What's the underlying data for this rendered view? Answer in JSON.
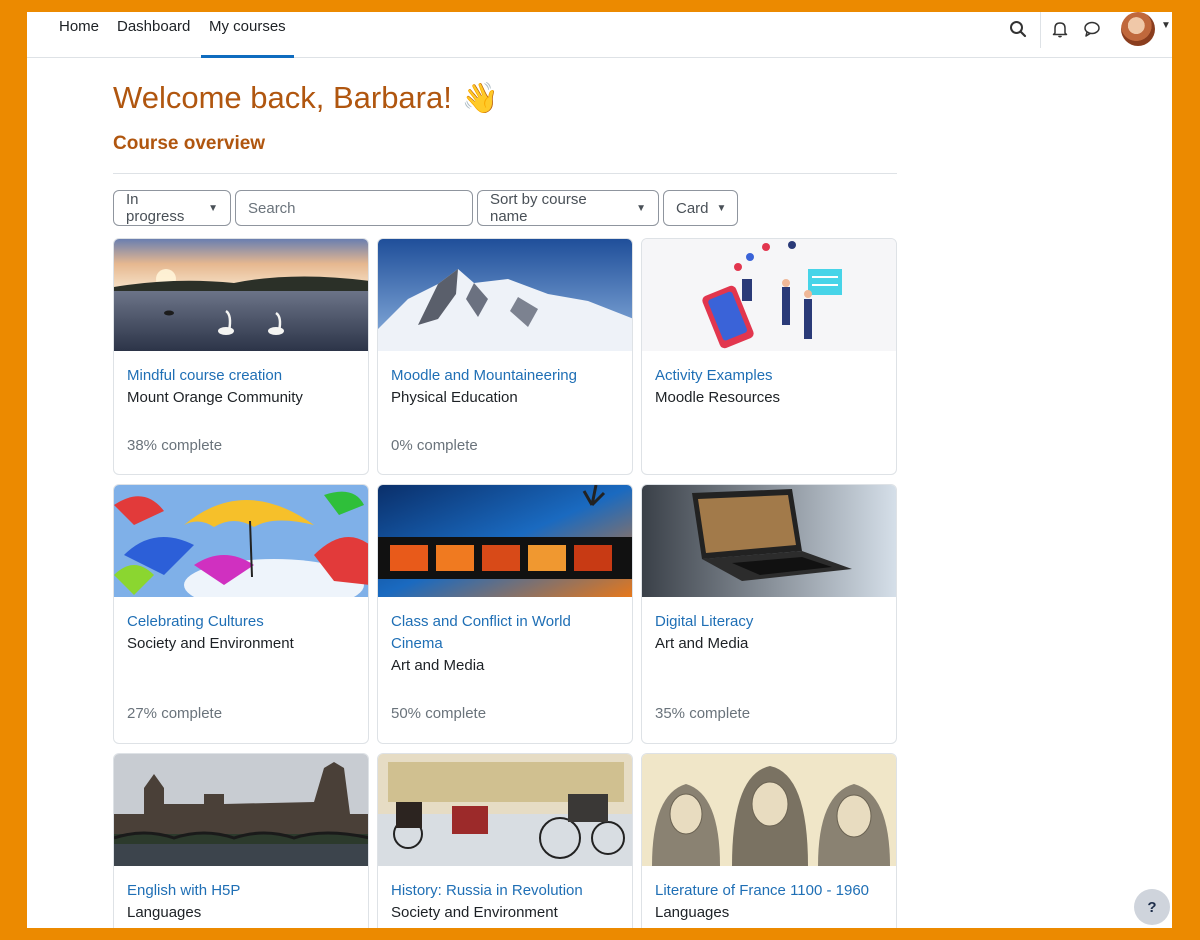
{
  "nav": {
    "links": [
      {
        "label": "Home"
      },
      {
        "label": "Dashboard"
      },
      {
        "label": "My courses"
      }
    ],
    "icons": [
      "search-icon",
      "bell-icon",
      "chat-icon",
      "avatar"
    ]
  },
  "page": {
    "welcome": "Welcome back, Barbara!",
    "wave_emoji": "👋",
    "section_title": "Course overview"
  },
  "filters": {
    "status": "In progress",
    "search_placeholder": "Search",
    "sort": "Sort by course name",
    "view": "Card"
  },
  "courses": [
    {
      "title": "Mindful course creation",
      "category": "Mount Orange Community",
      "progress": "38% complete"
    },
    {
      "title": "Moodle and Mountaineering",
      "category": "Physical Education",
      "progress": "0% complete"
    },
    {
      "title": "Activity Examples",
      "category": "Moodle Resources",
      "progress": ""
    },
    {
      "title": "Celebrating Cultures",
      "category": "Society and Environment",
      "progress": "27% complete"
    },
    {
      "title": "Class and Conflict in World Cinema",
      "category": "Art and Media",
      "progress": "50% complete"
    },
    {
      "title": "Digital Literacy",
      "category": "Art and Media",
      "progress": "35% complete"
    },
    {
      "title": "English with H5P",
      "category": "Languages",
      "progress": ""
    },
    {
      "title": "History: Russia in Revolution",
      "category": "Society and Environment",
      "progress": ""
    },
    {
      "title": "Literature of France 1100 - 1960",
      "category": "Languages",
      "progress": ""
    }
  ],
  "help_label": "?",
  "colors": {
    "accent": "#0f6cbf",
    "heading": "#b0560f",
    "frame": "#ec8a00"
  }
}
